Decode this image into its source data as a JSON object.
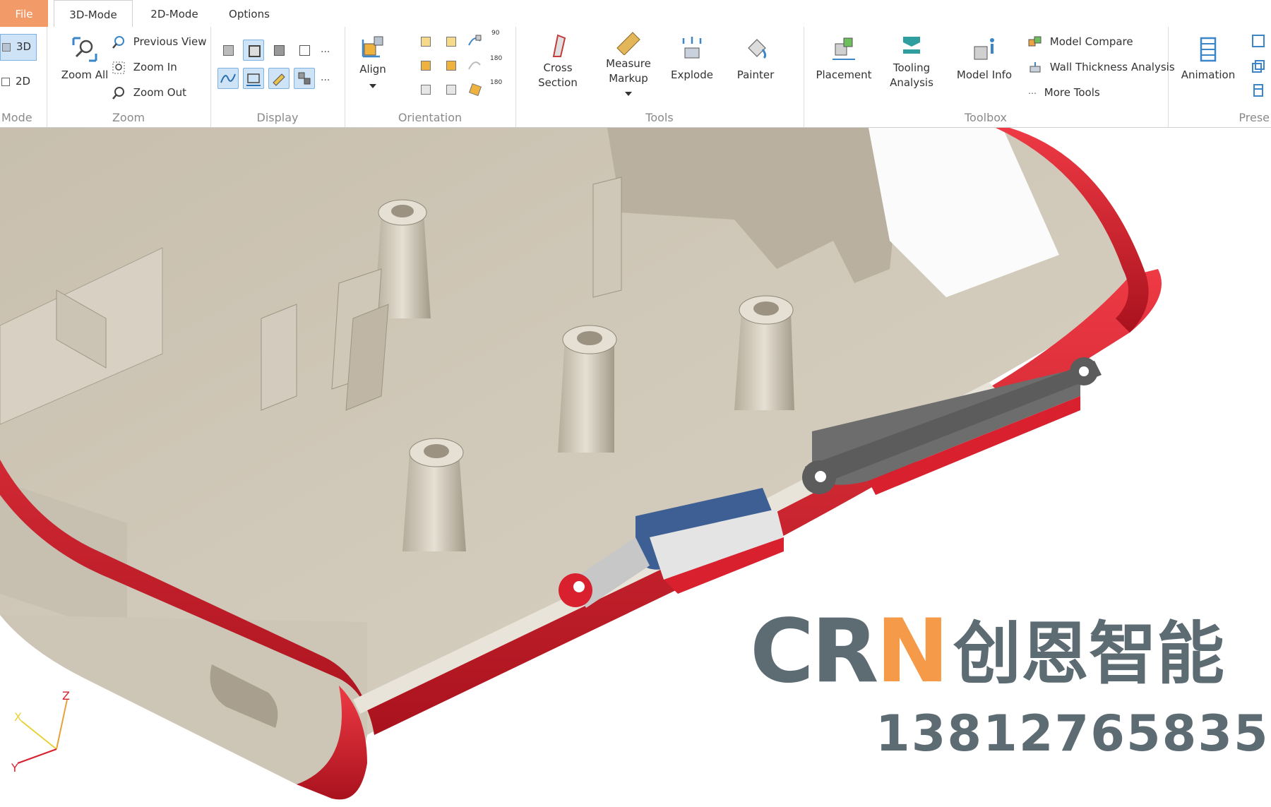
{
  "tabs": {
    "file": "File",
    "mode3d": "3D-Mode",
    "mode2d": "2D-Mode",
    "options": "Options"
  },
  "ribbon": {
    "mode": {
      "label": "Mode",
      "btn3d": "3D",
      "btn2d": "2D"
    },
    "zoom": {
      "label": "Zoom",
      "zoom_all_line1": "Zoom All",
      "previous_view": "Previous View",
      "zoom_in": "Zoom In",
      "zoom_out": "Zoom Out"
    },
    "display": {
      "label": "Display",
      "more": "...",
      "more2": "..."
    },
    "orientation": {
      "label": "Orientation",
      "align": "Align",
      "rot_90": "90",
      "rot_180a": "180",
      "rot_180b": "180"
    },
    "tools": {
      "label": "Tools",
      "cross_line1": "Cross",
      "cross_line2": "Section",
      "measure_line1": "Measure",
      "measure_line2": "Markup",
      "explode": "Explode",
      "painter": "Painter"
    },
    "toolbox": {
      "label": "Toolbox",
      "placement": "Placement",
      "tooling_line1": "Tooling",
      "tooling_line2": "Analysis",
      "model_info": "Model Info",
      "model_compare": "Model Compare",
      "wall_thickness": "Wall Thickness Analysis",
      "more_tools": "More Tools"
    },
    "presentation": {
      "label": "Prese",
      "animation": "Animation"
    }
  },
  "viewport": {
    "axes": {
      "x": "X",
      "y": "Y",
      "z": "Z"
    },
    "watermark": {
      "crn_c": "C",
      "crn_r": "R",
      "crn_n": "N",
      "cn": "创恩智能",
      "phone": "13812765835"
    }
  },
  "colors": {
    "file_tab": "#f29a68",
    "selected": "#cfe3f7",
    "housing": "#cfc6b6",
    "bumper": "#d8202f",
    "watermark_gray": "#5d6b72",
    "watermark_orange": "#f59a48"
  }
}
